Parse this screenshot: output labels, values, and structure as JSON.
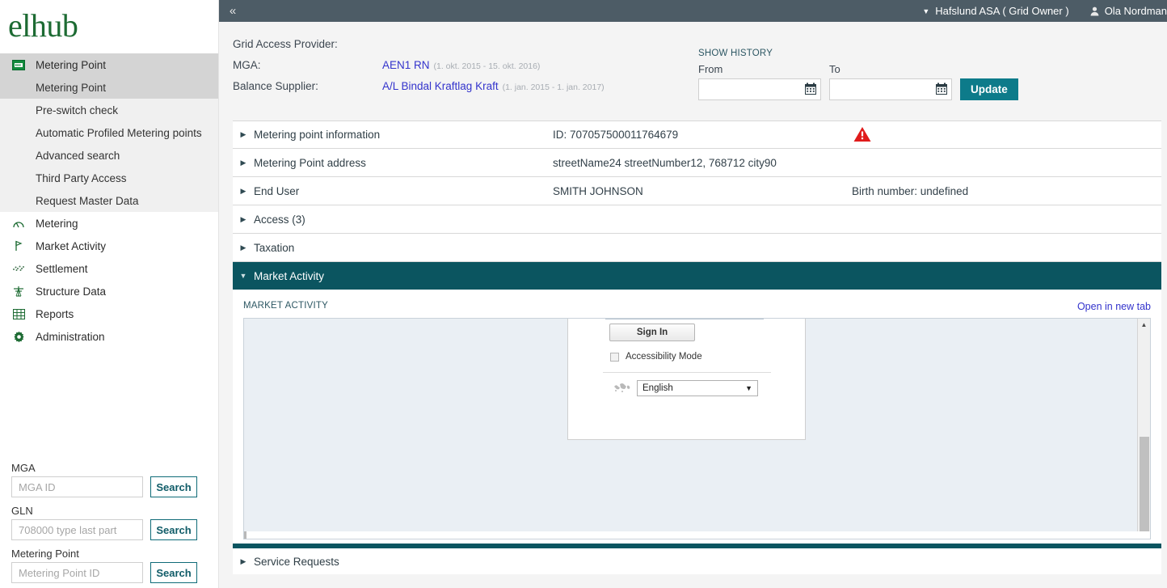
{
  "topbar": {
    "collapse_icon": "chevron-double-left-icon",
    "org_caret_icon": "caret-down-icon",
    "org_name": "Hafslund ASA ( Grid Owner )",
    "user_icon": "user-icon",
    "user_name": "Ola Nordman"
  },
  "sidebar": {
    "logo_text": "elhub",
    "groups": [
      {
        "label": "Metering Point",
        "icon": "meter-icon",
        "active": true,
        "items": [
          {
            "label": "Metering Point",
            "selected": true
          },
          {
            "label": "Pre-switch check",
            "selected": false
          },
          {
            "label": "Automatic Profiled Metering points",
            "selected": false
          },
          {
            "label": "Advanced search",
            "selected": false
          },
          {
            "label": "Third Party Access",
            "selected": false
          },
          {
            "label": "Request Master Data",
            "selected": false
          }
        ]
      },
      {
        "label": "Metering",
        "icon": "gauge-icon",
        "active": false,
        "items": []
      },
      {
        "label": "Market Activity",
        "icon": "flag-icon",
        "active": false,
        "items": []
      },
      {
        "label": "Settlement",
        "icon": "scatter-icon",
        "active": false,
        "items": []
      },
      {
        "label": "Structure Data",
        "icon": "pylon-icon",
        "active": false,
        "items": []
      },
      {
        "label": "Reports",
        "icon": "table-icon",
        "active": false,
        "items": []
      },
      {
        "label": "Administration",
        "icon": "gear-icon",
        "active": false,
        "items": []
      }
    ],
    "search_fields": [
      {
        "label": "MGA",
        "placeholder": "MGA ID",
        "value": "",
        "button": "Search"
      },
      {
        "label": "GLN",
        "placeholder": "708000 type last part",
        "value": "",
        "button": "Search"
      },
      {
        "label": "Metering Point",
        "placeholder": "Metering Point ID",
        "value": "",
        "button": "Search"
      }
    ]
  },
  "info": {
    "rows": [
      {
        "key": "Grid Access Provider:",
        "value": "",
        "dates": "",
        "link": false
      },
      {
        "key": "MGA:",
        "value": "AEN1 RN",
        "dates": "(1. okt. 2015 - 15. okt. 2016)",
        "link": true
      },
      {
        "key": "Balance Supplier:",
        "value": "A/L Bindal Kraftlag Kraft",
        "dates": "(1. jan. 2015 - 1. jan. 2017)",
        "link": true
      }
    ]
  },
  "history": {
    "title": "SHOW HISTORY",
    "from_label": "From",
    "from_value": "",
    "from_placeholder": "",
    "to_label": "To",
    "to_value": "",
    "to_placeholder": "",
    "calendar_icon": "calendar-icon",
    "update_label": "Update"
  },
  "accordion": {
    "collapsed_arrow": "caret-right-icon",
    "expanded_arrow": "caret-down-icon",
    "rows": [
      {
        "title": "Metering point information",
        "mid": "ID: 707057500011764679",
        "right": "",
        "warning": true
      },
      {
        "title": "Metering Point address",
        "mid": "streetName24 streetNumber12, 768712 city90",
        "right": "",
        "warning": false
      },
      {
        "title": "End User",
        "mid": "SMITH JOHNSON",
        "right": "Birth number: undefined",
        "warning": false
      },
      {
        "title": "Access (3)",
        "mid": "",
        "right": "",
        "warning": false
      },
      {
        "title": "Taxation",
        "mid": "",
        "right": "",
        "warning": false
      }
    ],
    "warning_icon": "warning-triangle-icon"
  },
  "market_activity": {
    "header_title": "Market Activity",
    "panel_label": "MARKET ACTIVITY",
    "open_new_tab": "Open in new tab",
    "embedded": {
      "signin_label": "Sign In",
      "accessibility_label": "Accessibility Mode",
      "accessibility_checked": false,
      "globe_icon": "globe-icon",
      "language_value": "English",
      "language_caret": "caret-down-icon"
    },
    "scroll_up_icon": "scroll-up-arrow-icon"
  },
  "service_requests": {
    "title": "Service Requests",
    "arrow": "caret-right-icon"
  },
  "colors": {
    "brand_green": "#1d6b33",
    "teal": "#0b5560",
    "teal_button": "#0d7b8a",
    "topbar": "#4d5c66",
    "link_blue": "#3333cc",
    "warning_red": "#e01b1b"
  }
}
